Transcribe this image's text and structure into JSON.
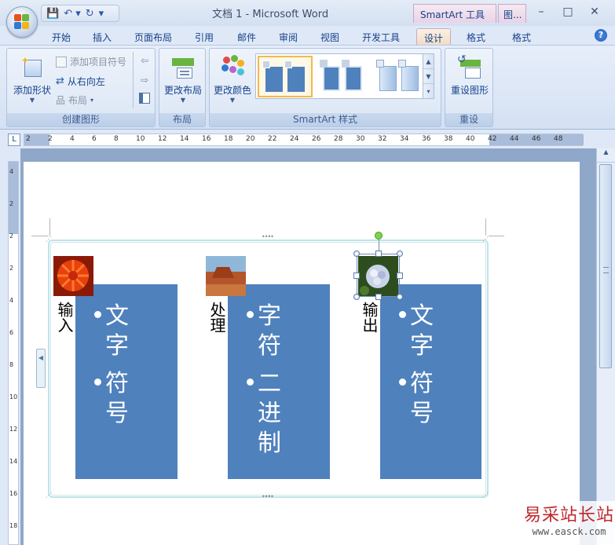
{
  "window": {
    "title": "文档 1 - Microsoft Word",
    "context_tab_group": "SmartArt 工具",
    "context_tab_group2": "图...",
    "minimize": "–",
    "maximize": "□",
    "close": "✕"
  },
  "qat": {
    "save": "💾",
    "undo": "↶ ▾",
    "redo": "↻",
    "more": "▾"
  },
  "tabs": [
    {
      "label": "开始"
    },
    {
      "label": "插入"
    },
    {
      "label": "页面布局"
    },
    {
      "label": "引用"
    },
    {
      "label": "邮件"
    },
    {
      "label": "审阅"
    },
    {
      "label": "视图"
    },
    {
      "label": "开发工具"
    },
    {
      "label": "设计"
    },
    {
      "label": "格式"
    },
    {
      "label": "格式"
    }
  ],
  "active_tab": "设计",
  "ribbon": {
    "create_graphic": {
      "label": "创建图形",
      "add_shape": "添加形状",
      "add_bullet": "添加项目符号",
      "right_to_left": "从右向左",
      "layout": "布局"
    },
    "layouts": {
      "label": "布局",
      "change_layout": "更改布局"
    },
    "styles": {
      "label": "SmartArt 样式",
      "change_colors": "更改颜色"
    },
    "reset": {
      "label": "重设",
      "reset_graphic": "重设图形"
    }
  },
  "ruler": {
    "numbers": [
      "2",
      "2",
      "4",
      "6",
      "8",
      "10",
      "12",
      "14",
      "16",
      "18",
      "20",
      "22",
      "24",
      "26",
      "28",
      "30",
      "32",
      "34",
      "36",
      "38",
      "40",
      "42",
      "44",
      "46",
      "48"
    ]
  },
  "vruler": {
    "numbers": [
      "4",
      "2",
      "2",
      "2",
      "4",
      "6",
      "8",
      "10",
      "12",
      "14",
      "16",
      "18"
    ]
  },
  "smartart": {
    "items": [
      {
        "label": "输入",
        "bullets": [
          "文字",
          "符号"
        ]
      },
      {
        "label": "处理",
        "bullets": [
          "字符",
          "二进制"
        ]
      },
      {
        "label": "输出",
        "bullets": [
          "文字",
          "符号"
        ]
      }
    ]
  },
  "watermark": {
    "text": "易采站长站",
    "url": "www.easck.com"
  },
  "colors": {
    "accent": "#4f81bd",
    "ribbon_bg": "#dbe6f5",
    "context_tab": "#e9d3e6"
  }
}
